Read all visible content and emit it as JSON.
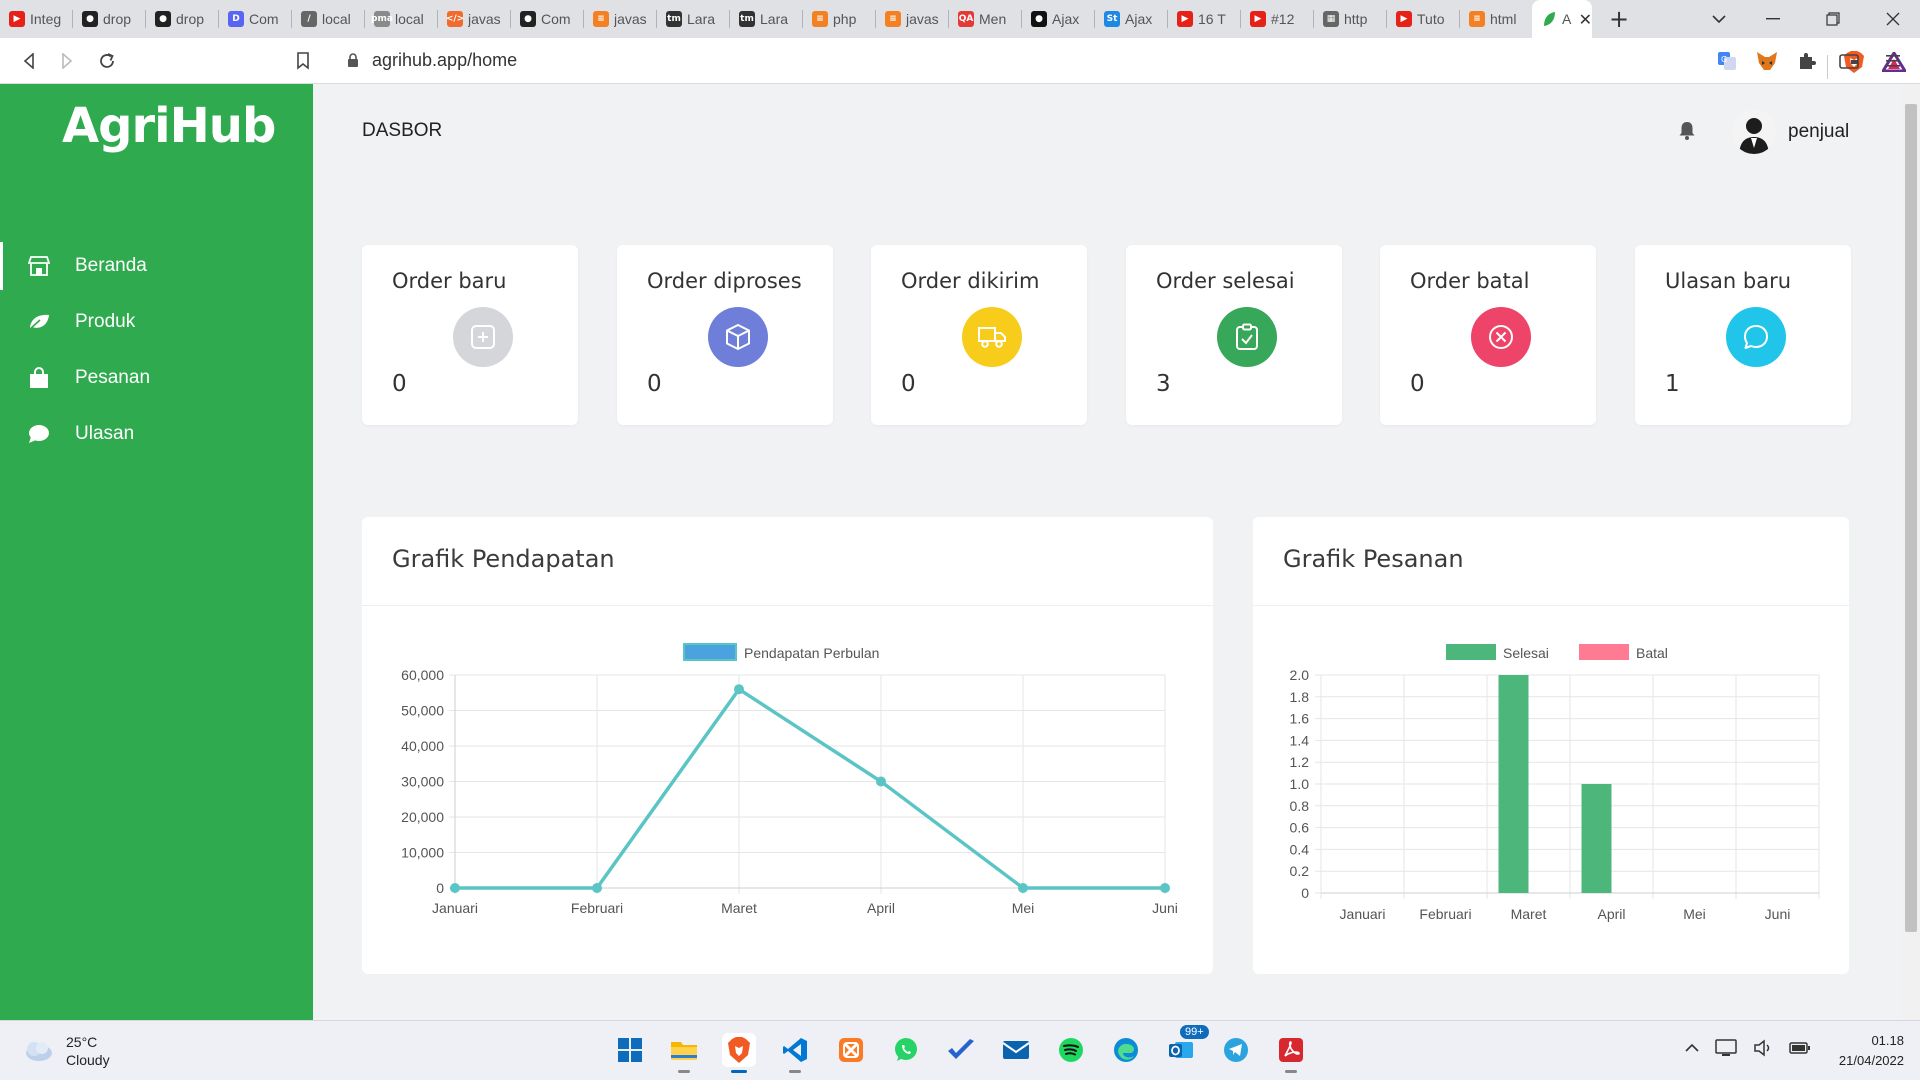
{
  "browser": {
    "tabs": [
      {
        "title": "Integ",
        "icon": "youtube-icon",
        "color": "#e62117"
      },
      {
        "title": "drop",
        "icon": "github-icon",
        "color": "#222222"
      },
      {
        "title": "drop",
        "icon": "github-icon",
        "color": "#222222"
      },
      {
        "title": "Com",
        "icon": "discord-icon",
        "color": "#5865f2"
      },
      {
        "title": "local",
        "icon": "leaf-icon",
        "color": "#666666"
      },
      {
        "title": "local",
        "icon": "pma-icon",
        "color": "#8a8a8a"
      },
      {
        "title": "javas",
        "icon": "code-icon",
        "color": "#f26b2e"
      },
      {
        "title": "Com",
        "icon": "github-icon",
        "color": "#222222"
      },
      {
        "title": "javas",
        "icon": "stackoverflow-icon",
        "color": "#f48024"
      },
      {
        "title": "Lara",
        "icon": "tm-icon",
        "color": "#333333"
      },
      {
        "title": "Lara",
        "icon": "tm-icon",
        "color": "#333333"
      },
      {
        "title": "php",
        "icon": "stackoverflow-icon",
        "color": "#f48024"
      },
      {
        "title": "javas",
        "icon": "stackoverflow-icon",
        "color": "#f48024"
      },
      {
        "title": "Men",
        "icon": "qa-icon",
        "color": "#e53935"
      },
      {
        "title": "Ajax",
        "icon": "globe-icon",
        "color": "#111111"
      },
      {
        "title": "Ajax",
        "icon": "st-icon",
        "color": "#1e88e5"
      },
      {
        "title": "16 T",
        "icon": "youtube-icon",
        "color": "#e62117"
      },
      {
        "title": "#12",
        "icon": "youtube-icon",
        "color": "#e62117"
      },
      {
        "title": "http",
        "icon": "page-icon",
        "color": "#666666"
      },
      {
        "title": "Tuto",
        "icon": "youtube-icon",
        "color": "#e62117"
      },
      {
        "title": "html",
        "icon": "stackoverflow-icon",
        "color": "#f48024"
      }
    ],
    "active_tab": {
      "title": "A",
      "icon": "leaf-icon",
      "color": "#2faa4f"
    },
    "url": "agrihub.app/home"
  },
  "app": {
    "logo": "AgriHub",
    "page_title": "DASBOR",
    "username": "penjual",
    "nav": [
      {
        "label": "Beranda",
        "icon": "store-icon",
        "active": true
      },
      {
        "label": "Produk",
        "icon": "leaf-icon",
        "active": false
      },
      {
        "label": "Pesanan",
        "icon": "shopping-bag-icon",
        "active": false
      },
      {
        "label": "Ulasan",
        "icon": "chat-bubble-icon",
        "active": false
      }
    ],
    "stats": [
      {
        "title": "Order baru",
        "value": "0",
        "icon": "plus-square-icon",
        "color": "#d4d6da"
      },
      {
        "title": "Order diproses",
        "value": "0",
        "icon": "box-icon",
        "color": "#6f7ed8"
      },
      {
        "title": "Order dikirim",
        "value": "0",
        "icon": "truck-icon",
        "color": "#f8cc1b"
      },
      {
        "title": "Order selesai",
        "value": "3",
        "icon": "clipboard-check-icon",
        "color": "#37a75a"
      },
      {
        "title": "Order batal",
        "value": "0",
        "icon": "x-circle-icon",
        "color": "#ef4469"
      },
      {
        "title": "Ulasan baru",
        "value": "1",
        "icon": "message-circle-icon",
        "color": "#22c5ea"
      }
    ],
    "revenue_panel_title": "Grafik Pendapatan",
    "orders_panel_title": "Grafik Pesanan"
  },
  "chart_data": [
    {
      "type": "line",
      "categories": [
        "Januari",
        "Februari",
        "Maret",
        "April",
        "Mei",
        "Juni"
      ],
      "series": [
        {
          "name": "Pendapatan Perbulan",
          "values": [
            0,
            0,
            56000,
            30000,
            0,
            0
          ],
          "color": "#5bc4c4"
        }
      ],
      "ylim": [
        0,
        60000
      ],
      "yticks": [
        "60,000",
        "50,000",
        "40,000",
        "30,000",
        "20,000",
        "10,000",
        "0"
      ],
      "legend": "top-center",
      "grid": true
    },
    {
      "type": "bar",
      "categories": [
        "Januari",
        "Februari",
        "Maret",
        "April",
        "Mei",
        "Juni"
      ],
      "series": [
        {
          "name": "Selesai",
          "values": [
            0,
            0,
            2,
            1,
            0,
            0
          ],
          "color": "#4db77b"
        },
        {
          "name": "Batal",
          "values": [
            0,
            0,
            0,
            0,
            0,
            0
          ],
          "color": "#ff7a93"
        }
      ],
      "ylim": [
        0,
        2
      ],
      "yticks": [
        "2.0",
        "1.8",
        "1.6",
        "1.4",
        "1.2",
        "1.0",
        "0.8",
        "0.6",
        "0.4",
        "0.2",
        "0"
      ],
      "legend": "top-center",
      "grid": true
    }
  ],
  "taskbar": {
    "weather_temp": "25°C",
    "weather_desc": "Cloudy",
    "badge": "99+",
    "time": "01.18",
    "date": "21/04/2022",
    "apps": [
      {
        "icon": "windows-start-icon"
      },
      {
        "icon": "file-explorer-icon"
      },
      {
        "icon": "brave-icon"
      },
      {
        "icon": "vscode-icon"
      },
      {
        "icon": "xampp-icon"
      },
      {
        "icon": "whatsapp-icon"
      },
      {
        "icon": "todo-icon"
      },
      {
        "icon": "mail-icon"
      },
      {
        "icon": "spotify-icon"
      },
      {
        "icon": "edge-icon"
      },
      {
        "icon": "outlook-icon"
      },
      {
        "icon": "telegram-icon"
      },
      {
        "icon": "acrobat-icon"
      }
    ]
  }
}
